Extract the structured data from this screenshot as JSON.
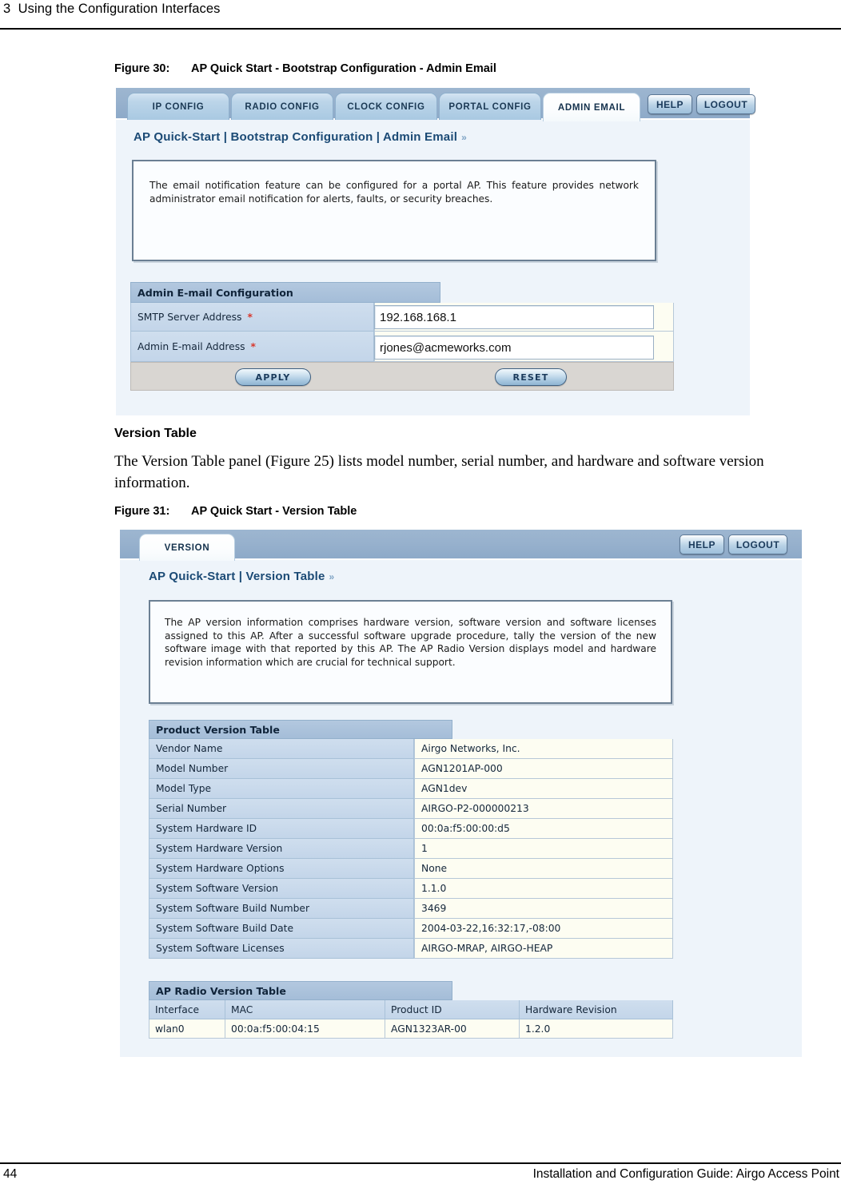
{
  "page": {
    "chapter_header": "3  Using the Configuration Interfaces",
    "footer_page_number": "44",
    "footer_title": "Installation and Configuration Guide: Airgo Access Point"
  },
  "figure30": {
    "caption_number": "Figure 30:",
    "caption_text": "AP Quick Start - Bootstrap Configuration - Admin Email",
    "tabs": [
      {
        "label": "IP CONFIG",
        "active": false
      },
      {
        "label": "RADIO CONFIG",
        "active": false
      },
      {
        "label": "CLOCK CONFIG",
        "active": false
      },
      {
        "label": "PORTAL CONFIG",
        "active": false
      },
      {
        "label": "ADMIN EMAIL",
        "active": true
      }
    ],
    "help_label": "HELP",
    "logout_label": "LOGOUT",
    "breadcrumb": "AP Quick-Start | Bootstrap Configuration | Admin Email",
    "info_text": "The email notification feature can be configured for a portal AP. This feature provides network administrator email notification for alerts, faults, or security breaches.",
    "panel_title": "Admin E-mail Configuration",
    "fields": [
      {
        "label": "SMTP Server Address",
        "required": "*",
        "value": "192.168.168.1"
      },
      {
        "label": "Admin E-mail Address",
        "required": "*",
        "value": "rjones@acmeworks.com"
      }
    ],
    "apply_label": "APPLY",
    "reset_label": "RESET"
  },
  "version_section": {
    "heading": "Version Table",
    "paragraph": "The Version Table panel (Figure 25) lists model number, serial number, and hardware and software version information."
  },
  "figure31": {
    "caption_number": "Figure 31:",
    "caption_text": "AP Quick Start - Version Table",
    "tabs": [
      {
        "label": "VERSION",
        "active": true
      }
    ],
    "help_label": "HELP",
    "logout_label": "LOGOUT",
    "breadcrumb": "AP Quick-Start | Version Table",
    "info_text": "The AP version information comprises hardware version, software version and software licenses assigned to this AP. After a successful software upgrade procedure, tally the version of the new software image with that reported by this AP. The AP Radio Version displays model and hardware revision information which are crucial for technical support.",
    "product_table": {
      "title": "Product Version Table",
      "rows": [
        {
          "label": "Vendor Name",
          "value": "Airgo Networks, Inc."
        },
        {
          "label": "Model Number",
          "value": "AGN1201AP-000"
        },
        {
          "label": "Model Type",
          "value": "AGN1dev"
        },
        {
          "label": "Serial Number",
          "value": "AIRGO-P2-000000213"
        },
        {
          "label": "System Hardware ID",
          "value": "00:0a:f5:00:00:d5"
        },
        {
          "label": "System Hardware Version",
          "value": "1"
        },
        {
          "label": "System Hardware Options",
          "value": "None"
        },
        {
          "label": "System Software Version",
          "value": "1.1.0"
        },
        {
          "label": "System Software Build Number",
          "value": "3469"
        },
        {
          "label": "System Software Build Date",
          "value": "2004-03-22,16:32:17,-08:00"
        },
        {
          "label": "System Software Licenses",
          "value": "AIRGO-MRAP, AIRGO-HEAP"
        }
      ]
    },
    "radio_table": {
      "title": "AP Radio Version Table",
      "columns": [
        "Interface",
        "MAC",
        "Product ID",
        "Hardware Revision"
      ],
      "rows": [
        [
          "wlan0",
          "00:0a:f5:00:04:15",
          "AGN1323AR-00",
          "1.2.0"
        ]
      ]
    }
  },
  "colors": {
    "topbar_blue": "#9db6d0",
    "tab_blue": "#a9c9e2",
    "panel_header_blue": "#a4bdd8",
    "row_label_blue": "#c3d5e9",
    "value_cream": "#fdfdf2",
    "shot_bg": "#eef4fa",
    "required_red": "#d8372b"
  }
}
